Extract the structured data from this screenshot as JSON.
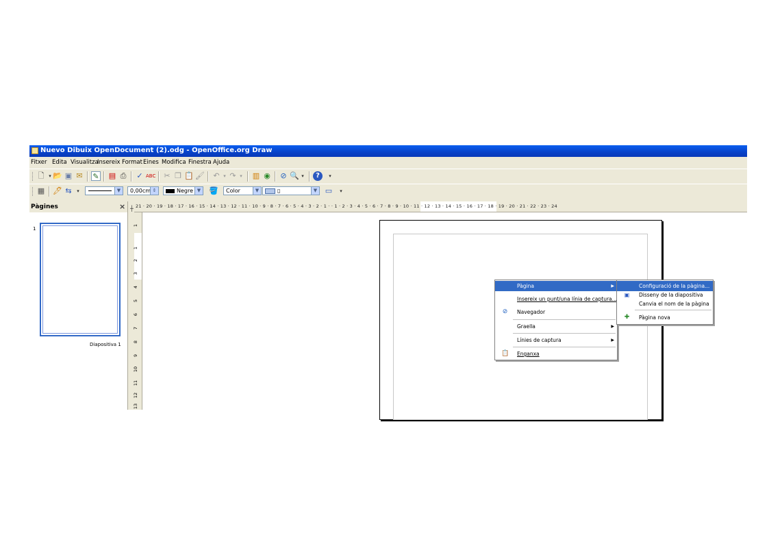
{
  "window": {
    "title": "Nuevo Dibuix OpenDocument (2).odg - OpenOffice.org Draw"
  },
  "menu": [
    "Fitxer",
    "Edita",
    "Visualitza",
    "Insereix",
    "Format",
    "Eines",
    "Modifica",
    "Finestra",
    "Ajuda"
  ],
  "toolbar2": {
    "line_width": "0,00cm",
    "line_color": "Negre",
    "area_style": "Color",
    "area_color": "▯"
  },
  "slides_pane": {
    "title": "Pàgines",
    "close_glyph": "×",
    "slide_number": "1",
    "slide_label": "Diapositiva 1"
  },
  "ruler": {
    "horizontal": "21 · 20 · 19 · 18 · 17 · 16 · 15 · 14 · 13 · 12 · 11 · 10 · 9 · 8 · 7 · 6 · 5 · 4 · 3 · 2 · 1 ·    · 1 · 2 · 3 · 4 · 5 · 6 · 7 · 8 · 9 · 10 · 11 · 12 · 13 · 14 · 15 · 16 · 17 · 18 · 19 · 20 · 21 · 22 · 23 · 24",
    "vertical": [
      "1",
      "1",
      "2",
      "3",
      "4",
      "5",
      "6",
      "7",
      "8",
      "9",
      "10",
      "11",
      "12",
      "13"
    ]
  },
  "context_menu": {
    "items": [
      {
        "label": "Pàgina",
        "submenu": true,
        "selected": true
      },
      {
        "label": "Insereix un punt/una línia de captura...",
        "submenu": false
      },
      {
        "label": "Navegador",
        "submenu": false,
        "icon": "navigator-icon"
      },
      {
        "label": "Graella",
        "submenu": true
      },
      {
        "label": "Línies de captura",
        "submenu": true
      },
      {
        "label": "Enganxa",
        "submenu": false,
        "icon": "paste-icon"
      }
    ]
  },
  "submenu": {
    "items": [
      {
        "label": "Configuració de la pàgina...",
        "selected": true
      },
      {
        "label": "Disseny de la diapositiva",
        "icon": "slide-design-icon"
      },
      {
        "label": "Canvia el nom de la pàgina"
      },
      {
        "label": "Pàgina nova",
        "icon": "new-page-icon"
      }
    ]
  },
  "colors": {
    "titlebar": "#0a5ef0",
    "selection": "#316ac5",
    "chrome": "#ece9d8"
  }
}
